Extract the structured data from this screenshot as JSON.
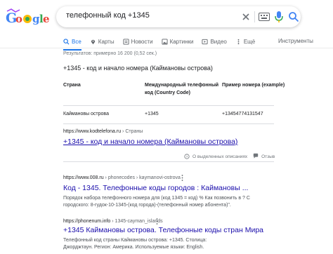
{
  "header": {
    "logo_alt": "Google",
    "query": "телефонный код +1345"
  },
  "tabs": [
    {
      "label": "Все",
      "icon": "search-icon",
      "active": true
    },
    {
      "label": "Карты",
      "icon": "map-pin-icon"
    },
    {
      "label": "Новости",
      "icon": "news-icon"
    },
    {
      "label": "Картинки",
      "icon": "image-icon"
    },
    {
      "label": "Видео",
      "icon": "video-icon"
    },
    {
      "label": "Ещё",
      "icon": "more-icon"
    }
  ],
  "tools_label": "Инструменты",
  "stats": "Результатов: примерно 16 200 (0,52 сек.)",
  "featured": {
    "title": "+1345 - код и начало номера (Каймановы острова)",
    "table": {
      "headers": [
        "Страна",
        "Международный телефонный код (Country Code)",
        "Пример номера (example)"
      ],
      "rows": [
        [
          "Каймановы острова",
          "+1345",
          "+13454774131547"
        ]
      ]
    },
    "url": "https://www.kodtelefona.ru",
    "crumb": " › Страны",
    "link_title": "+1345 - код и начало номера (Каймановы острова)",
    "about": "О выделенных описаниях",
    "feedback": "Отзыв"
  },
  "results": [
    {
      "url": "https://www.008.ru",
      "crumb": " › phonecodes › kaymanovi-ostrova",
      "title": "Код - 1345. Телефонные коды городов : Каймановы ...",
      "desc_1": "Порядок набора телефонного номера для (код 1345 = код) % Как позвонить в ? С",
      "desc_2": "городского: 8-гудок-10-1345-(код города)-(телефонный номер абонента)\"."
    },
    {
      "url": "https://phonenum.info",
      "crumb": " › 1345-cayman_islands",
      "title": "+1345 Каймановы острова. Телефонные коды стран Мира",
      "desc_1": "Телефонный код страны Каймановы острова: +1345. Столица:",
      "desc_2": "Джорджтаун. Регион: Америка. Используемые языки: English."
    }
  ],
  "colors": {
    "link": "#1a0dab",
    "accent": "#1a73e8",
    "muted": "#70757a"
  }
}
